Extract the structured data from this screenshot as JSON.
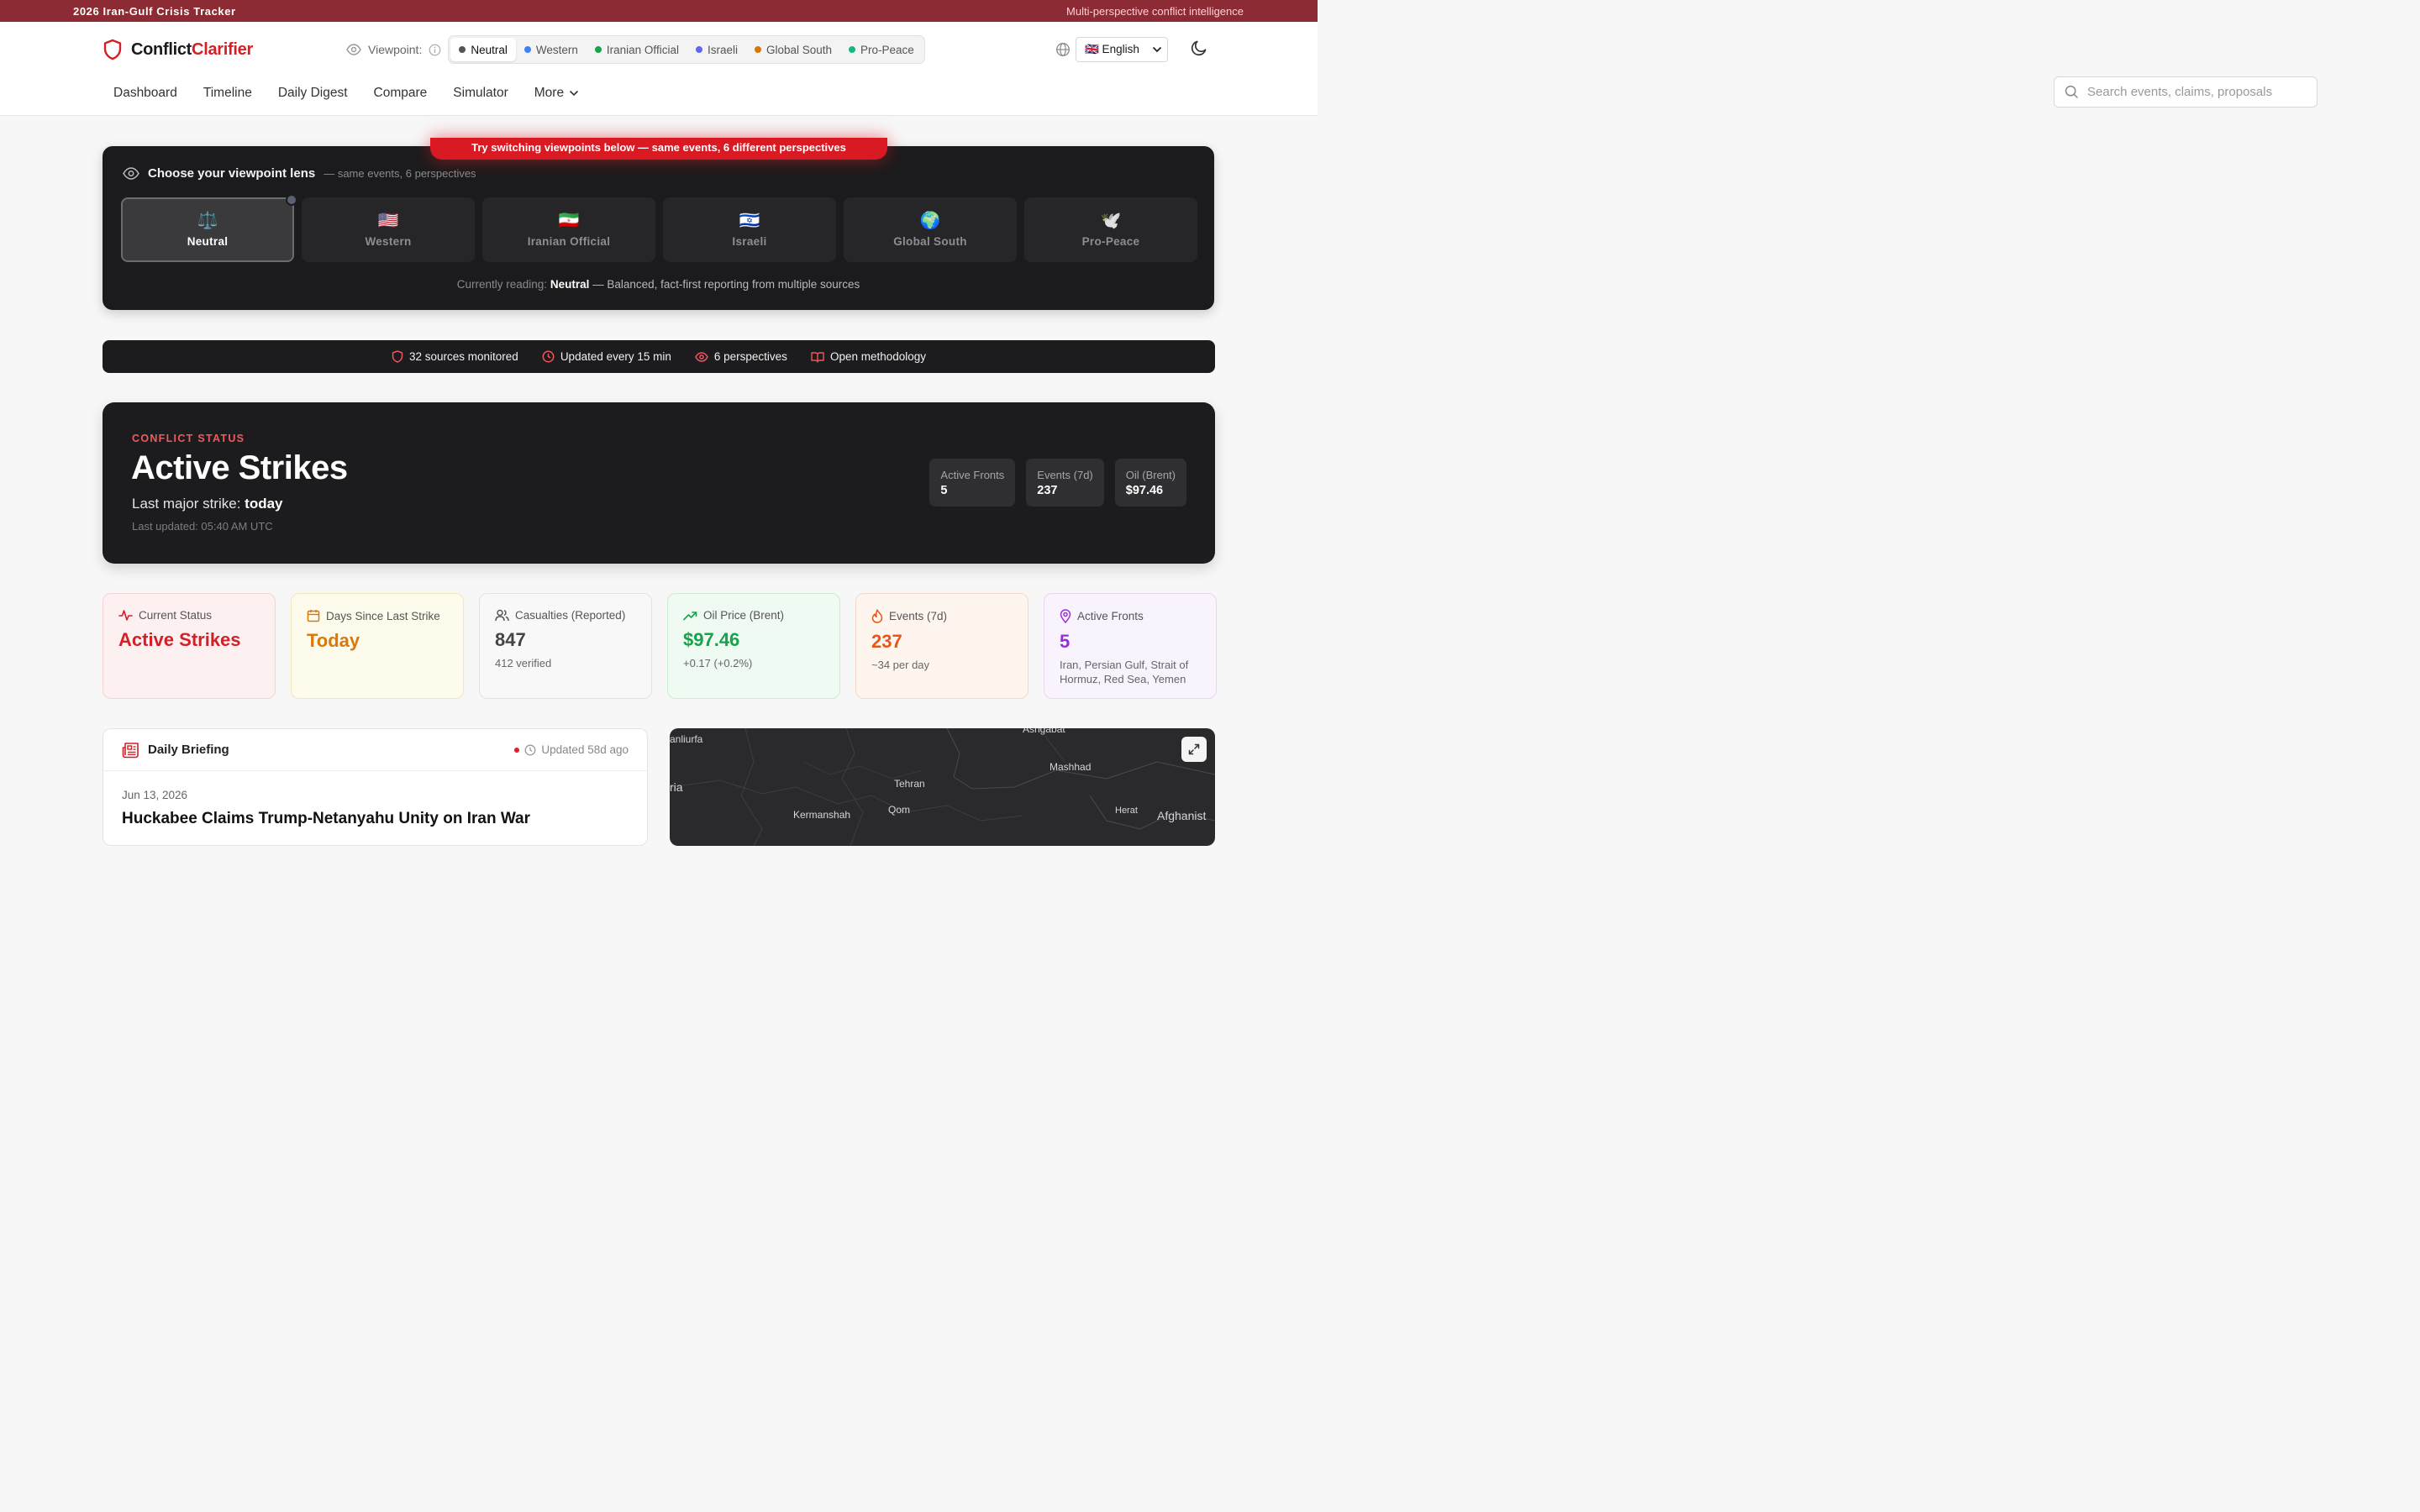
{
  "banner": {
    "title": "2026 Iran-Gulf Crisis Tracker",
    "subtitle": "Multi-perspective conflict intelligence"
  },
  "brand": {
    "part1": "Conflict",
    "part2": "Clarifier",
    "accent": "#d41f26"
  },
  "viewpoint_bar": {
    "label": "Viewpoint:",
    "options": [
      {
        "label": "Neutral",
        "color": "#555555",
        "active": true
      },
      {
        "label": "Western",
        "color": "#3b82f6",
        "active": false
      },
      {
        "label": "Iranian Official",
        "color": "#16a34a",
        "active": false
      },
      {
        "label": "Israeli",
        "color": "#6366f1",
        "active": false
      },
      {
        "label": "Global South",
        "color": "#d97706",
        "active": false
      },
      {
        "label": "Pro-Peace",
        "color": "#10b981",
        "active": false
      }
    ]
  },
  "language": {
    "selected": "🇬🇧 English"
  },
  "nav": {
    "items": [
      "Dashboard",
      "Timeline",
      "Daily Digest",
      "Compare",
      "Simulator"
    ],
    "more": "More"
  },
  "search": {
    "placeholder": "Search events, claims, proposals..."
  },
  "lens": {
    "hint": "Try switching viewpoints below — same events, 6 different perspectives",
    "title": "Choose your viewpoint lens",
    "subtitle": "— same events, 6 perspectives",
    "cards": [
      {
        "emoji": "⚖️",
        "label": "Neutral",
        "active": true
      },
      {
        "emoji": "🇺🇸",
        "label": "Western",
        "active": false
      },
      {
        "emoji": "🇮🇷",
        "label": "Iranian Official",
        "active": false
      },
      {
        "emoji": "🇮🇱",
        "label": "Israeli",
        "active": false
      },
      {
        "emoji": "🌍",
        "label": "Global South",
        "active": false
      },
      {
        "emoji": "🕊️",
        "label": "Pro-Peace",
        "active": false
      }
    ],
    "reading_prefix": "Currently reading:",
    "reading_name": "Neutral",
    "reading_desc": "— Balanced, fact-first reporting from multiple sources"
  },
  "strip": {
    "sources": "32 sources monitored",
    "updated": "Updated every 15 min",
    "perspectives": "6 perspectives",
    "methodology": "Open methodology"
  },
  "status": {
    "kicker": "CONFLICT STATUS",
    "title": "Active Strikes",
    "last_strike_label": "Last major strike:",
    "last_strike_value": "today",
    "last_updated": "Last updated: 05:40 AM UTC",
    "metrics": [
      {
        "label": "Active Fronts",
        "value": "5"
      },
      {
        "label": "Events (7d)",
        "value": "237"
      },
      {
        "label": "Oil (Brent)",
        "value": "$97.46"
      }
    ]
  },
  "cards": [
    {
      "label": "Current Status",
      "value": "Active Strikes",
      "sub": "",
      "icon": "activity-icon",
      "color": "#d41f26"
    },
    {
      "label": "Days Since Last Strike",
      "value": "Today",
      "sub": "",
      "icon": "calendar-icon",
      "color": "#d9780b"
    },
    {
      "label": "Casualties (Reported)",
      "value": "847",
      "sub": "412 verified",
      "icon": "users-icon",
      "color": "#555555"
    },
    {
      "label": "Oil Price (Brent)",
      "value": "$97.46",
      "sub": "+0.17 (+0.2%)",
      "icon": "trending-up-icon",
      "color": "#16a34a"
    },
    {
      "label": "Events (7d)",
      "value": "237",
      "sub": "~34 per day",
      "icon": "flame-icon",
      "color": "#e8561a"
    },
    {
      "label": "Active Fronts",
      "value": "5",
      "sub": "Iran, Persian Gulf, Strait of Hormuz, Red Sea, Yemen",
      "icon": "map-pin-icon",
      "color": "#9b2fd6"
    }
  ],
  "briefing": {
    "title": "Daily Briefing",
    "updated": "Updated 58d ago",
    "date": "Jun 13, 2026",
    "headline": "Huckabee Claims Trump-Netanyahu Unity on Iran War"
  },
  "map": {
    "places": [
      "anliurfa",
      "Ashgabat",
      "Mashhad",
      "ria",
      "Tehran",
      "Kermanshah",
      "Qom",
      "Herat",
      "Afghanist"
    ]
  }
}
